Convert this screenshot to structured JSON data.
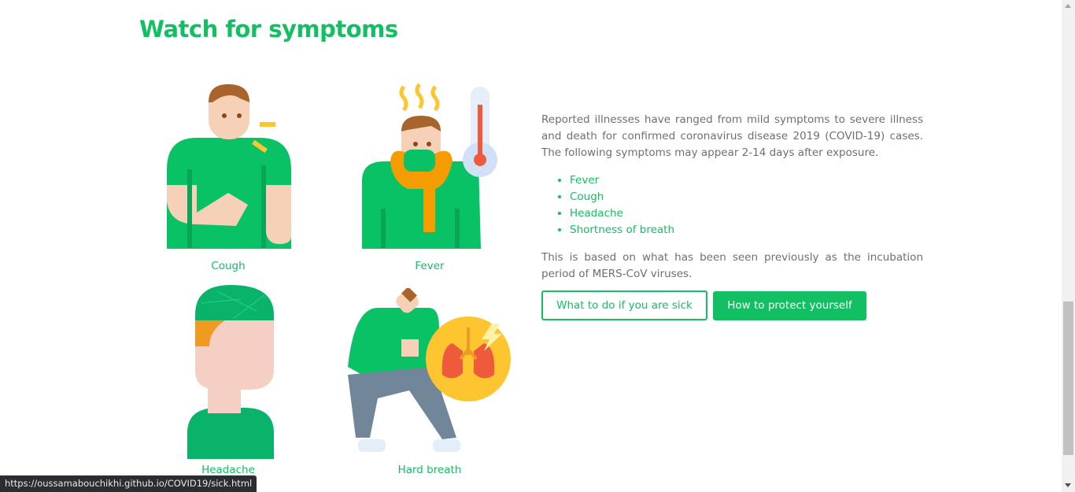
{
  "title": "Watch for symptoms",
  "symptoms": [
    {
      "label": "Cough",
      "icon": "cough-illustration"
    },
    {
      "label": "Fever",
      "icon": "fever-illustration"
    },
    {
      "label": "Headache",
      "icon": "headache-illustration"
    },
    {
      "label": "Hard breath",
      "icon": "hard-breath-illustration"
    }
  ],
  "intro": "Reported illnesses have ranged from mild symptoms to severe illness and death for confirmed coronavirus disease 2019 (COVID-19) cases. The following symptoms may appear 2-14 days after exposure.",
  "list": [
    "Fever",
    "Cough",
    "Headache",
    "Shortness of breath"
  ],
  "note": "This is based on what has been seen previously as the incubation period of MERS-CoV viruses.",
  "buttons": {
    "sick": "What to do if you are sick",
    "protect": "How to protect yourself"
  },
  "status_url": "https://oussamabouchikhi.github.io/COVID19/sick.html",
  "colors": {
    "accent": "#12bf62",
    "text": "#6b7075"
  }
}
